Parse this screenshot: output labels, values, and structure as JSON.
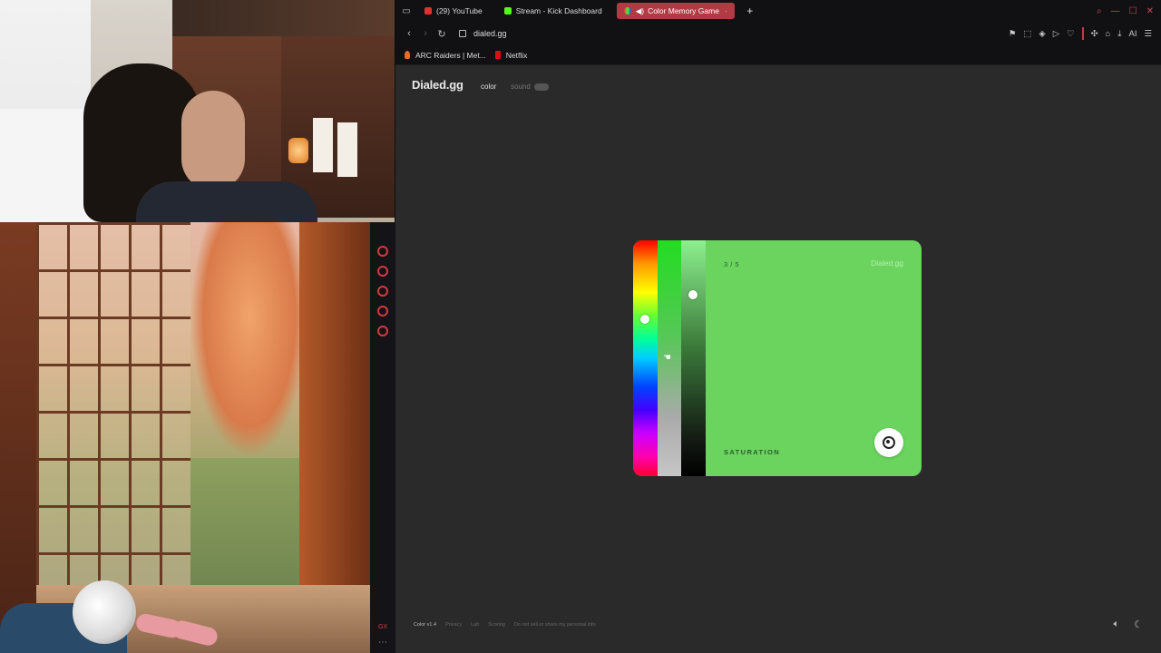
{
  "browser": {
    "tabs": [
      {
        "label": "(29) YouTube",
        "icon": "youtube-icon",
        "color": "#e03131"
      },
      {
        "label": "Stream - Kick Dashboard",
        "icon": "kick-icon",
        "color": "#53fc18"
      },
      {
        "label": "Color Memory Game",
        "icon": "dialed-icon",
        "color": "#ffffff",
        "active": true
      }
    ],
    "url": "dialed.gg",
    "bookmarks": [
      {
        "label": "ARC Raiders | Met...",
        "icon": "arc-raiders-icon",
        "color": "#e86b2a"
      },
      {
        "label": "Netflix",
        "icon": "netflix-icon",
        "color": "#e50914"
      }
    ],
    "toolbar_ai": "AI",
    "accent": "#b13a43"
  },
  "app": {
    "logo": "Dialed.gg",
    "modes": {
      "color": "color",
      "sound": "sound"
    },
    "card": {
      "counter": "3 / 5",
      "brand": "Dialed.gg",
      "stage": "SATURATION",
      "color": "#6ad45f"
    },
    "footer": {
      "version": "Color v1.4",
      "links": [
        "Privacy",
        "Lab",
        "Scoring",
        "Do not sell or share my personal info"
      ]
    }
  },
  "stream_rail": {
    "label": "GX"
  }
}
